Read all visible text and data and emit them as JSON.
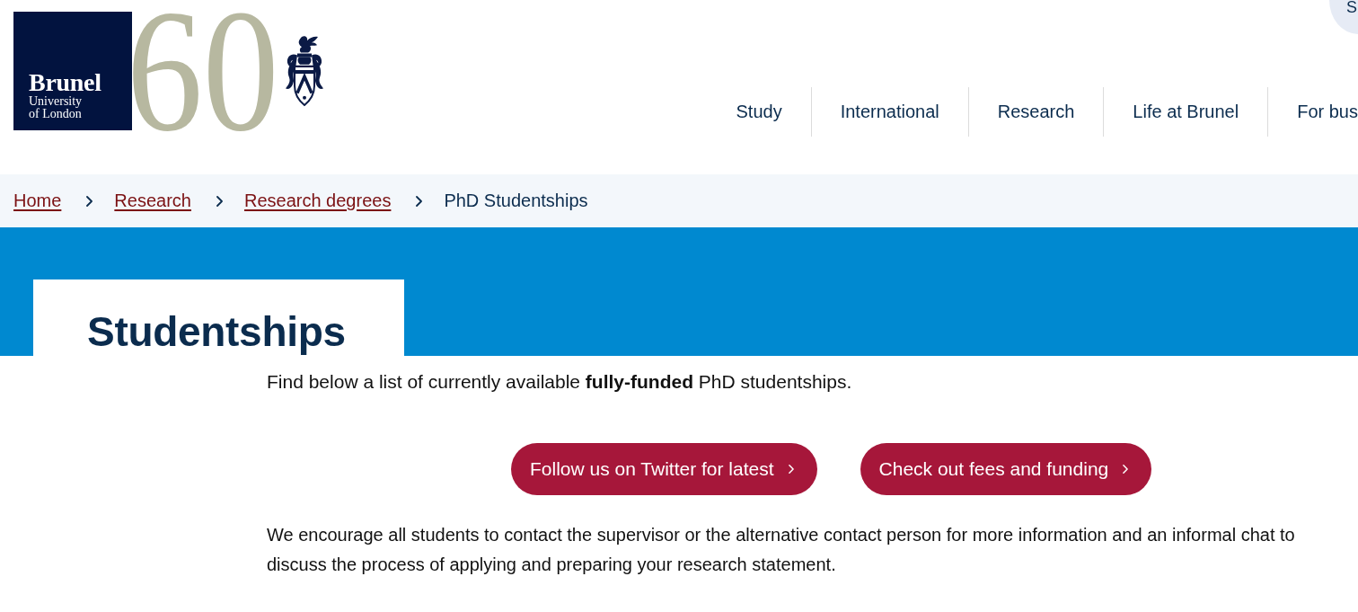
{
  "header": {
    "logo": {
      "wordmark": "Brunel",
      "subtitle": "University of London",
      "anniversary": "60"
    },
    "corner_button": {
      "label": "S"
    },
    "nav": [
      {
        "label": "Study"
      },
      {
        "label": "International"
      },
      {
        "label": "Research"
      },
      {
        "label": "Life at Brunel"
      },
      {
        "label": "For bus"
      }
    ]
  },
  "breadcrumb": [
    {
      "label": "Home",
      "kind": "link"
    },
    {
      "label": "Research",
      "kind": "link"
    },
    {
      "label": "Research degrees",
      "kind": "link"
    },
    {
      "label": "PhD Studentships",
      "kind": "current"
    }
  ],
  "hero": {
    "title": "Studentships"
  },
  "content": {
    "intro": "Find below a list of currently available **fully-funded** PhD studentships.",
    "buttons": [
      {
        "label": "Follow us on Twitter for latest"
      },
      {
        "label": "Check out fees and funding"
      }
    ],
    "note": "We encourage all students to contact the supervisor or the alternative contact person for more information and an informal chat to discuss the process of applying and preparing your research statement."
  }
}
